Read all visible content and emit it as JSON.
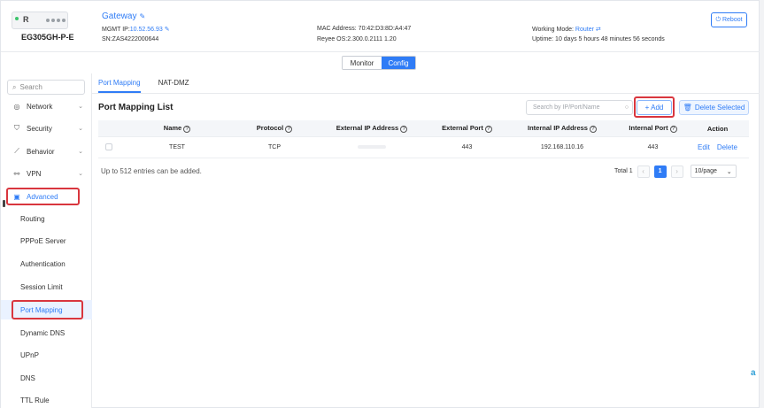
{
  "header": {
    "device_brand": "R",
    "device_model": "EG305GH-P-E",
    "title": "Gateway",
    "mgmt_ip_label": "MGMT IP:",
    "mgmt_ip_value": "10.52.56.93",
    "sn": "SN:ZAS4222000644",
    "mac": "MAC Address: 70:42:D3:8D:A4:47",
    "os": "Reyee OS:2.300.0.2111 1.20",
    "working_mode_label": "Working Mode:",
    "working_mode_value": "Router",
    "uptime": "Uptime: 10 days 5 hours 48 minutes 56 seconds",
    "reboot_label": "Reboot",
    "accent_color": "#2f7cf6"
  },
  "mode_switch": {
    "monitor": "Monitor",
    "config": "Config"
  },
  "sidebar": {
    "search_placeholder": "Search",
    "items": [
      {
        "label": "Network",
        "icon": "globe-icon"
      },
      {
        "label": "Security",
        "icon": "shield-icon"
      },
      {
        "label": "Behavior",
        "icon": "chart-icon"
      },
      {
        "label": "VPN",
        "icon": "link-icon"
      },
      {
        "label": "Advanced",
        "icon": "toolbox-icon"
      }
    ],
    "sub_items": [
      "Routing",
      "PPPoE Server",
      "Authentication",
      "Session Limit",
      "Port Mapping",
      "Dynamic DNS",
      "UPnP",
      "DNS",
      "TTL Rule"
    ]
  },
  "tabs": [
    "Port Mapping",
    "NAT-DMZ"
  ],
  "list": {
    "title": "Port Mapping List",
    "search_placeholder": "Search by IP/Port/Name",
    "add_label": "+ Add",
    "delete_selected_label": "Delete Selected"
  },
  "table": {
    "headers": [
      "Name",
      "Protocol",
      "External IP Address",
      "External Port",
      "Internal IP Address",
      "Internal Port",
      "Action"
    ],
    "rows": [
      {
        "name": "TEST",
        "protocol": "TCP",
        "external_ip": "",
        "external_port": "443",
        "internal_ip": "192.168.110.16",
        "internal_port": "443",
        "edit": "Edit",
        "delete": "Delete"
      }
    ]
  },
  "footer": {
    "limit_note": "Up to 512 entries can be added.",
    "total": "Total 1",
    "current_page": "1",
    "page_size": "10/page"
  }
}
